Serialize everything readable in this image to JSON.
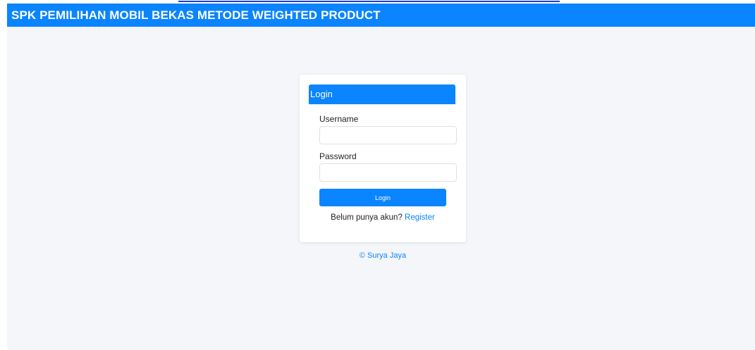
{
  "header": {
    "title": "SPK PEMILIHAN MOBIL BEKAS METODE WEIGHTED PRODUCT"
  },
  "login_card": {
    "title": "Login",
    "username_label": "Username",
    "username_value": "",
    "password_label": "Password",
    "password_value": "",
    "submit_label": "Login",
    "register_prompt": "Belum punya akun?",
    "register_link": "Register"
  },
  "footer": {
    "copyright": "© Surya Jaya"
  },
  "colors": {
    "primary": "#0a84ff",
    "background": "#f4f6f9",
    "card": "#ffffff"
  }
}
